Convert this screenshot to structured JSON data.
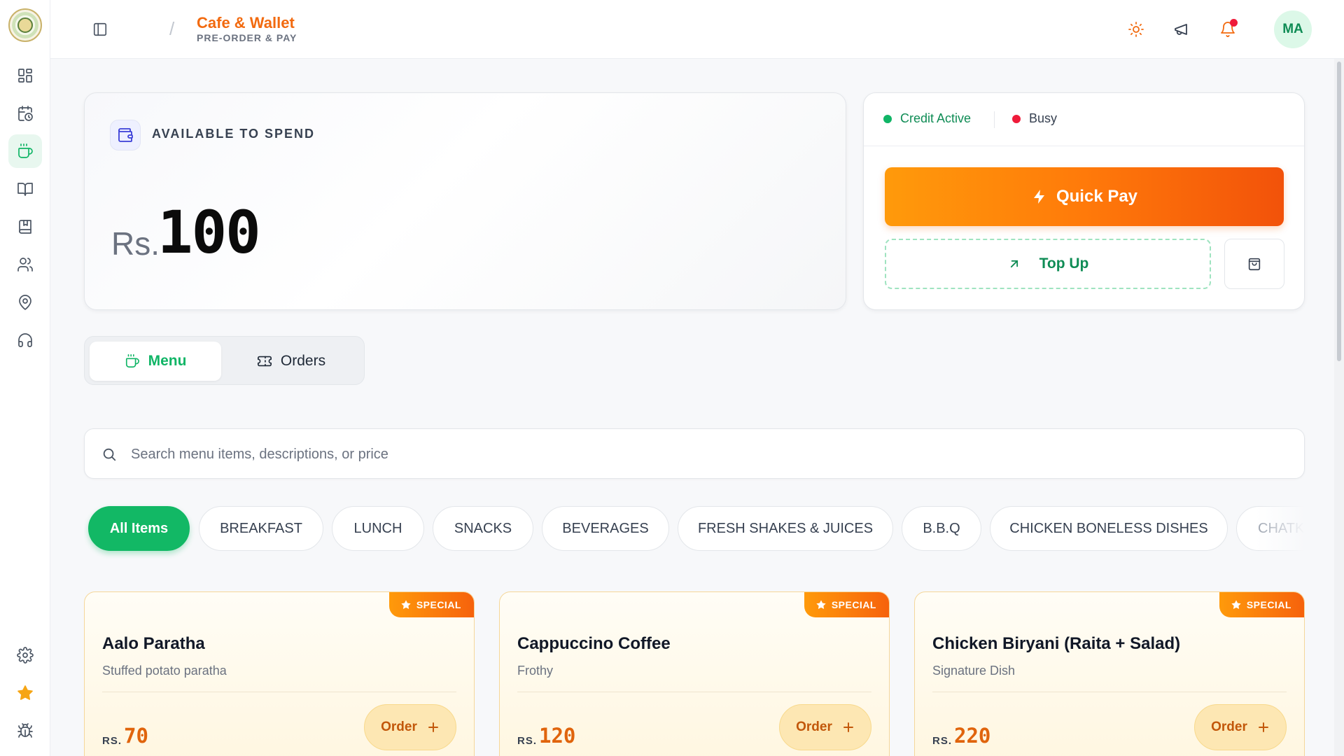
{
  "header": {
    "title": "Cafe & Wallet",
    "subtitle": "PRE-ORDER & PAY",
    "avatar_initials": "MA"
  },
  "sidebar": {
    "items": [
      {
        "icon": "dashboard-icon"
      },
      {
        "icon": "calendar-clock-icon"
      },
      {
        "icon": "coffee-icon",
        "active": true
      },
      {
        "icon": "book-open-icon"
      },
      {
        "icon": "bookmark-book-icon"
      },
      {
        "icon": "users-icon"
      },
      {
        "icon": "map-pin-icon"
      },
      {
        "icon": "headphones-icon"
      },
      {
        "icon": "gear-icon"
      },
      {
        "icon": "star-icon"
      },
      {
        "icon": "bug-icon"
      }
    ]
  },
  "wallet": {
    "label": "AVAILABLE TO SPEND",
    "currency": "Rs.",
    "balance": "100"
  },
  "status": {
    "credit": "Credit Active",
    "busy": "Busy"
  },
  "actions": {
    "quick_pay": "Quick Pay",
    "top_up": "Top Up"
  },
  "tabs": [
    {
      "label": "Menu",
      "active": true
    },
    {
      "label": "Orders",
      "active": false
    }
  ],
  "search": {
    "placeholder": "Search menu items, descriptions, or price"
  },
  "categories": [
    "All Items",
    "BREAKFAST",
    "LUNCH",
    "SNACKS",
    "BEVERAGES",
    "FRESH SHAKES & JUICES",
    "B.B.Q",
    "CHICKEN BONELESS DISHES",
    "CHATK"
  ],
  "menu_items": [
    {
      "badge": "SPECIAL",
      "name": "Aalo Paratha",
      "description": "Stuffed potato paratha",
      "price_label": "RS.",
      "price": "70",
      "order_label": "Order"
    },
    {
      "badge": "SPECIAL",
      "name": "Cappuccino Coffee",
      "description": "Frothy",
      "price_label": "RS.",
      "price": "120",
      "order_label": "Order"
    },
    {
      "badge": "SPECIAL",
      "name": "Chicken Biryani (Raita + Salad)",
      "description": "Signature Dish",
      "price_label": "RS.",
      "price": "220",
      "order_label": "Order"
    }
  ],
  "colors": {
    "brand_orange": "#f26a0f",
    "brand_green": "#10b566",
    "status_active": "#10b566",
    "status_busy": "#ef1b3a"
  }
}
